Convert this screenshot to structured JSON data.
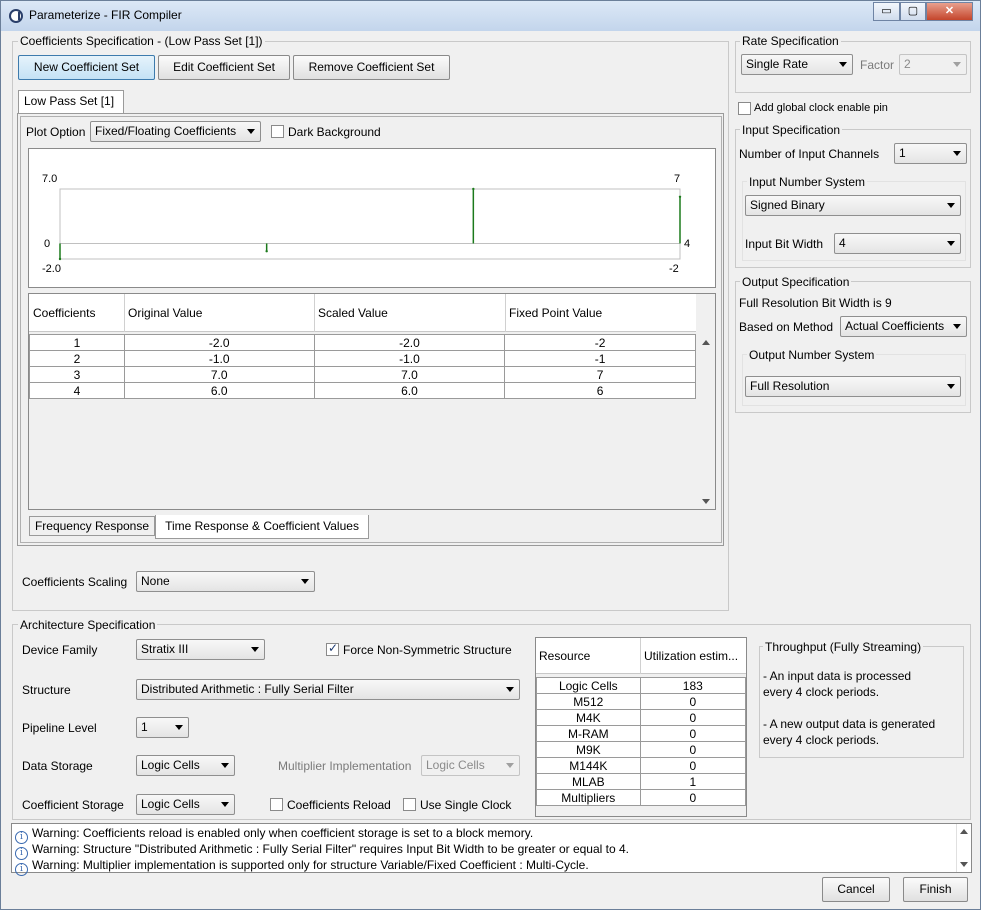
{
  "window": {
    "title": "Parameterize - FIR Compiler",
    "minimize": "▭",
    "maximize": "▢",
    "close": "✕"
  },
  "coeff_spec": {
    "group_label": "Coefficients Specification - (Low Pass Set [1])",
    "new_button": "New Coefficient Set",
    "edit_button": "Edit Coefficient Set",
    "remove_button": "Remove Coefficient Set",
    "set_tab": "Low Pass Set [1]",
    "plot_option_label": "Plot Option",
    "plot_option_value": "Fixed/Floating Coefficients",
    "dark_background_label": "Dark Background",
    "dark_background_checked": false,
    "plot": {
      "left_top": "7.0",
      "left_zero": "0",
      "left_bottom": "-2.0",
      "right_top": "7",
      "right_mid": "4",
      "right_bottom": "-2"
    },
    "table": {
      "headers": [
        "Coefficients",
        "Original Value",
        "Scaled Value",
        "Fixed Point Value"
      ],
      "rows": [
        [
          "1",
          "-2.0",
          "-2.0",
          "-2"
        ],
        [
          "2",
          "-1.0",
          "-1.0",
          "-1"
        ],
        [
          "3",
          "7.0",
          "7.0",
          "7"
        ],
        [
          "4",
          "6.0",
          "6.0",
          "6"
        ]
      ]
    },
    "bottom_tabs": [
      "Frequency Response",
      "Time Response & Coefficient Values"
    ],
    "scaling_label": "Coefficients Scaling",
    "scaling_value": "None"
  },
  "chart_data": {
    "type": "stem",
    "x": [
      1,
      2,
      3,
      4
    ],
    "values": [
      -2,
      -1,
      7,
      6
    ],
    "ylim": [
      -2,
      7
    ]
  },
  "rate_spec": {
    "group_label": "Rate Specification",
    "rate_value": "Single Rate",
    "factor_label": "Factor",
    "factor_value": "2",
    "global_clock_label": "Add global clock enable pin",
    "global_clock_checked": false
  },
  "input_spec": {
    "group_label": "Input Specification",
    "channels_label": "Number of Input Channels",
    "channels_value": "1",
    "number_system_label": "Input Number System",
    "number_system_value": "Signed Binary",
    "bit_width_label": "Input Bit Width",
    "bit_width_value": "4"
  },
  "output_spec": {
    "group_label": "Output Specification",
    "full_res_text": "Full Resolution Bit Width is 9",
    "method_label": "Based on Method",
    "method_value": "Actual Coefficients",
    "number_system_label": "Output Number System",
    "number_system_value": "Full Resolution"
  },
  "arch_spec": {
    "group_label": "Architecture Specification",
    "device_family_label": "Device Family",
    "device_family_value": "Stratix III",
    "force_nonsym_label": "Force Non-Symmetric Structure",
    "force_nonsym_checked": true,
    "structure_label": "Structure",
    "structure_value": "Distributed Arithmetic : Fully Serial Filter",
    "pipeline_label": "Pipeline Level",
    "pipeline_value": "1",
    "data_storage_label": "Data Storage",
    "data_storage_value": "Logic Cells",
    "multiplier_label": "Multiplier Implementation",
    "multiplier_value": "Logic Cells",
    "coeff_storage_label": "Coefficient Storage",
    "coeff_storage_value": "Logic Cells",
    "coeff_reload_label": "Coefficients Reload",
    "coeff_reload_checked": false,
    "single_clock_label": "Use Single Clock",
    "single_clock_checked": false
  },
  "resources": {
    "headers": [
      "Resource",
      "Utilization estim..."
    ],
    "rows": [
      [
        "Logic Cells",
        "183"
      ],
      [
        "M512",
        "0"
      ],
      [
        "M4K",
        "0"
      ],
      [
        "M-RAM",
        "0"
      ],
      [
        "M9K",
        "0"
      ],
      [
        "M144K",
        "0"
      ],
      [
        "MLAB",
        "1"
      ],
      [
        "Multipliers",
        "0"
      ]
    ]
  },
  "throughput": {
    "group_label": "Throughput (Fully Streaming)",
    "line1": "- An input data is processed",
    "line2": "every 4 clock periods.",
    "line3": "- A new output data is generated",
    "line4": "every 4 clock periods."
  },
  "messages": [
    "Warning: Coefficients reload is enabled only when coefficient storage is set to a block memory.",
    "Warning: Structure \"Distributed Arithmetic : Fully Serial Filter\" requires Input Bit Width to be greater or equal to 4.",
    "Warning: Multiplier implementation is supported only for structure Variable/Fixed Coefficient : Multi-Cycle."
  ],
  "footer": {
    "cancel": "Cancel",
    "finish": "Finish"
  }
}
